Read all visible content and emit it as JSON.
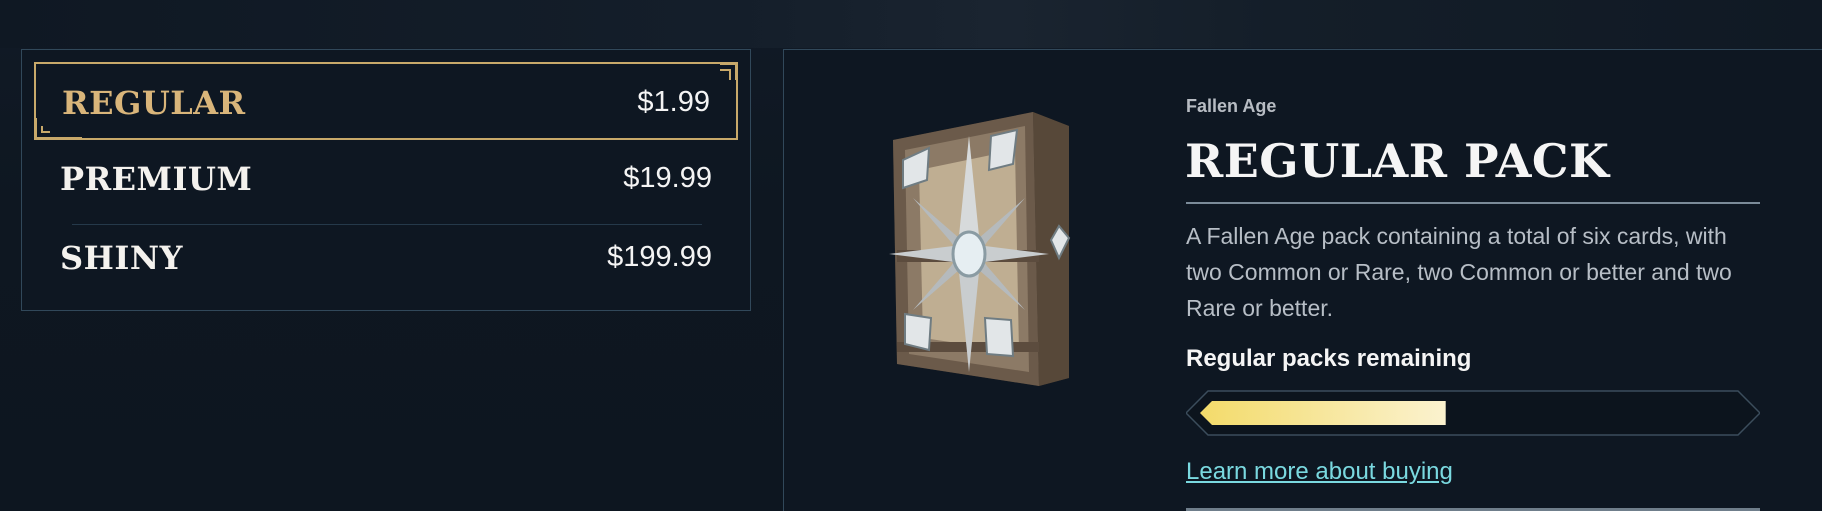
{
  "tiers": [
    {
      "name": "REGULAR",
      "price": "$1.99",
      "selected": true
    },
    {
      "name": "PREMIUM",
      "price": "$19.99",
      "selected": false
    },
    {
      "name": "SHINY",
      "price": "$199.99",
      "selected": false
    }
  ],
  "detail": {
    "franchise": "Fallen Age",
    "title": "REGULAR PACK",
    "description": "A Fallen Age pack containing a total of six cards, with two Common or Rare, two Common or better and two Rare or better.",
    "remaining_label": "Regular packs remaining",
    "remaining_fraction": 0.45,
    "learn_more": "Learn more about buying"
  },
  "colors": {
    "gold_accent": "#c8a96a",
    "selected_text": "#d9b57a",
    "link": "#7ad9e0",
    "progress_fill": "#f3df7d"
  },
  "icons": {
    "pack": "fallen-age-card-pack-icon"
  }
}
